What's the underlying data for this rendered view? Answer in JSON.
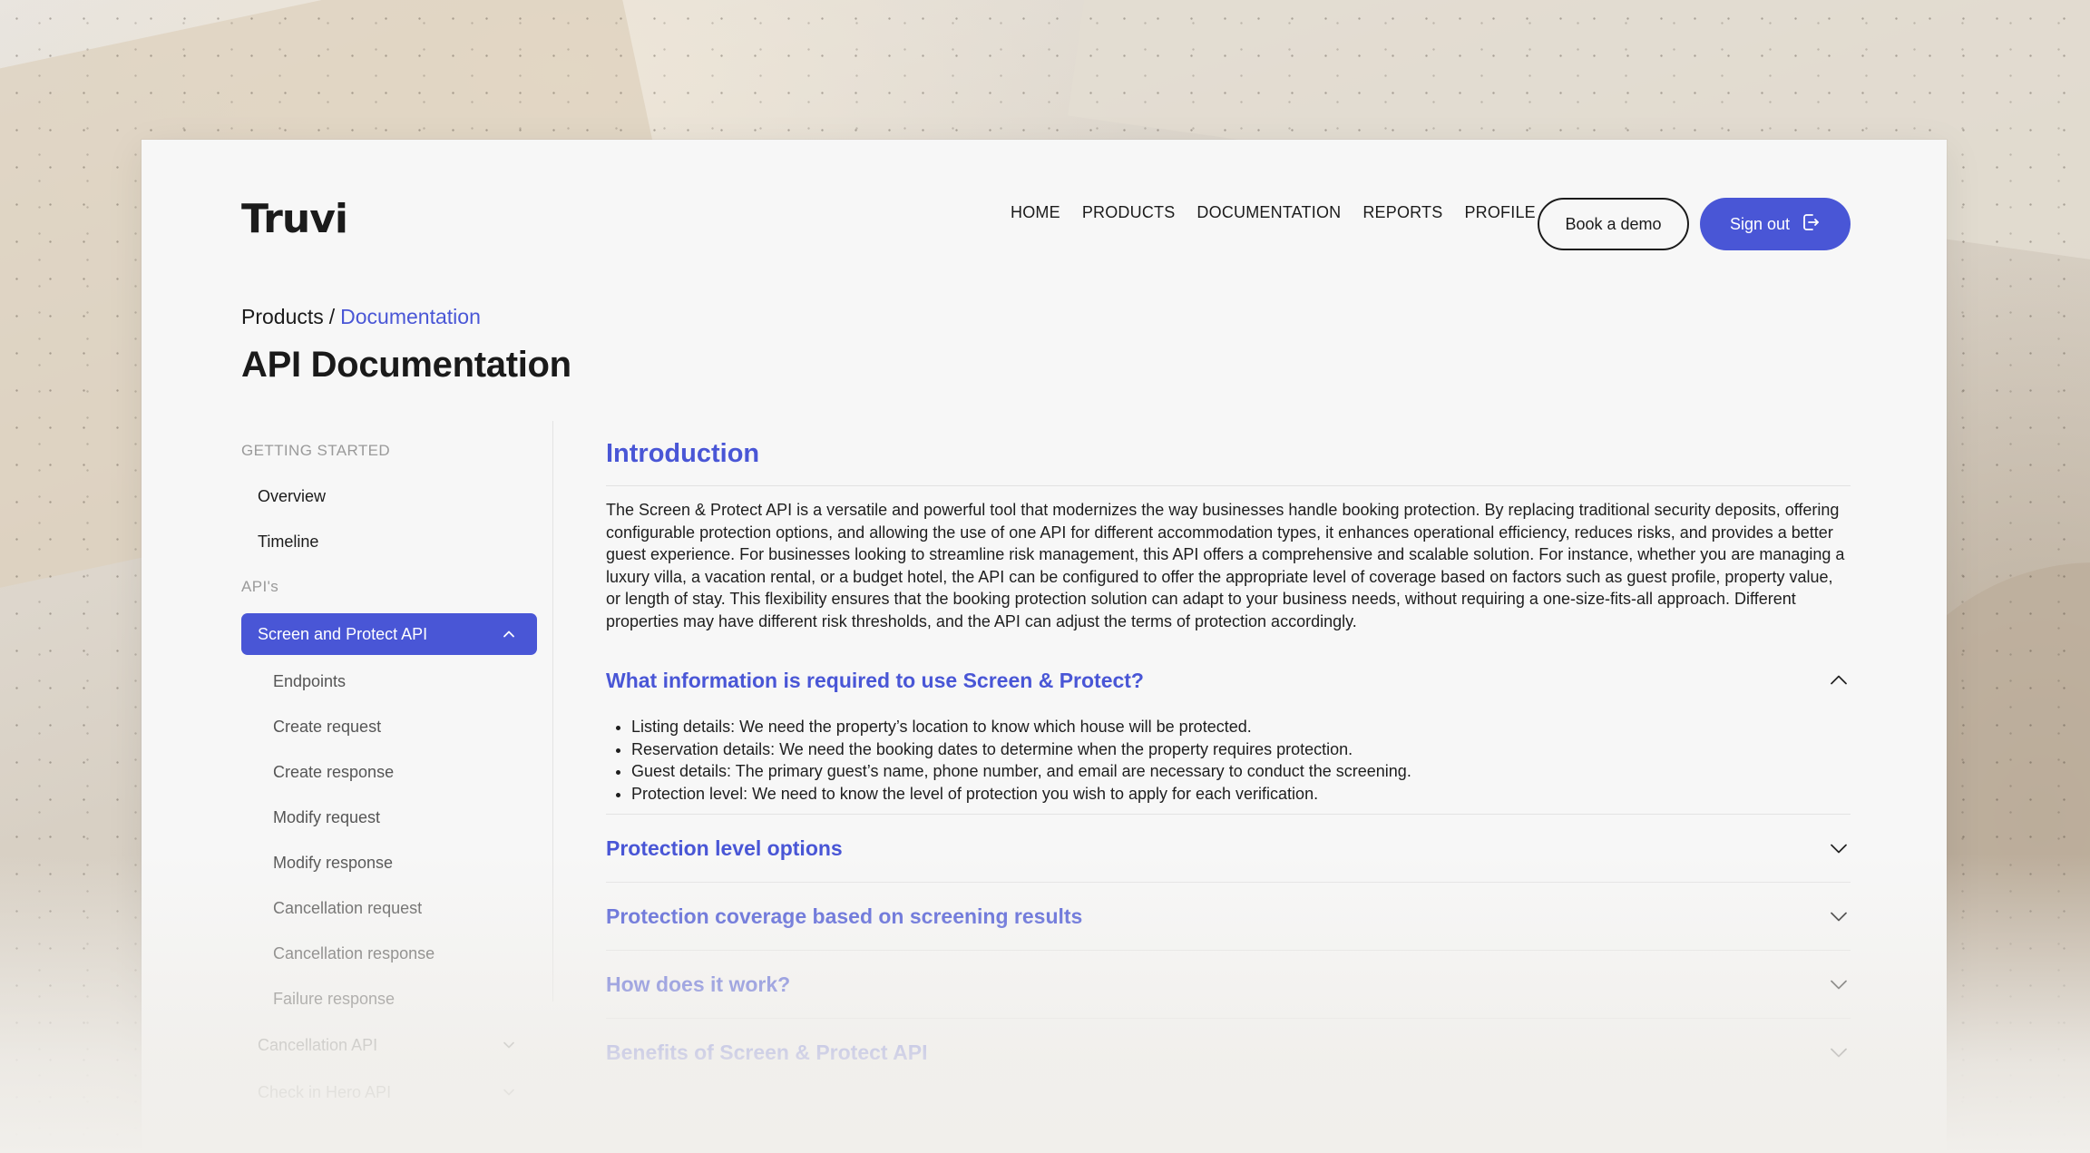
{
  "brand": {
    "logo": "Truvi",
    "accent": "#4956d6"
  },
  "nav": {
    "items": [
      "HOME",
      "PRODUCTS",
      "DOCUMENTATION",
      "REPORTS",
      "PROFILE"
    ]
  },
  "header": {
    "book_demo": "Book a demo",
    "sign_out": "Sign out"
  },
  "breadcrumb": {
    "root": "Products",
    "sep": "/",
    "current": "Documentation"
  },
  "page": {
    "title": "API Documentation"
  },
  "sidebar": {
    "getting_started": "GETTING STARTED",
    "gs_items": [
      "Overview",
      "Timeline"
    ],
    "apis": "API's",
    "active": "Screen and Protect API",
    "sub_items": [
      "Endpoints",
      "Create request",
      "Create response",
      "Modify request",
      "Modify response",
      "Cancellation request",
      "Cancellation response",
      "Failure response"
    ],
    "groups": [
      "Cancellation API",
      "Check in Hero API"
    ]
  },
  "intro": {
    "title": "Introduction",
    "text": "The Screen & Protect API is a versatile and powerful tool that modernizes the way businesses handle booking protection. By replacing traditional security deposits, offering configurable protection options, and allowing the use of one API for different accommodation types, it enhances operational efficiency, reduces risks, and provides a better guest experience. For businesses looking to streamline risk management, this API offers a comprehensive and scalable solution. For instance, whether you are managing a luxury villa, a vacation rental, or a budget hotel, the API can be configured to offer the appropriate level of coverage based on factors such as guest profile, property value, or length of stay. This flexibility ensures that the booking protection solution can adapt to your business needs, without requiring a one-size-fits-all approach. Different properties may have different risk thresholds, and the API can adjust the terms of protection accordingly."
  },
  "accordions": [
    {
      "title": "What information is required to use Screen & Protect?",
      "expanded": true,
      "items": [
        "Listing details: We need the property’s location to know which house will be protected.",
        "Reservation details: We need the booking dates to determine when the property requires protection.",
        "Guest details: The primary guest’s name, phone number, and email are necessary to conduct the screening.",
        "Protection level: We need to know the level of protection you wish to apply for each verification."
      ]
    },
    {
      "title": "Protection level options",
      "expanded": false
    },
    {
      "title": "Protection coverage based on screening results",
      "expanded": false
    },
    {
      "title": "How does it work?",
      "expanded": false
    },
    {
      "title": "Benefits of Screen & Protect API",
      "expanded": false
    }
  ],
  "icons": [
    "sign-out-icon",
    "chevron-up-icon",
    "chevron-down-icon"
  ]
}
